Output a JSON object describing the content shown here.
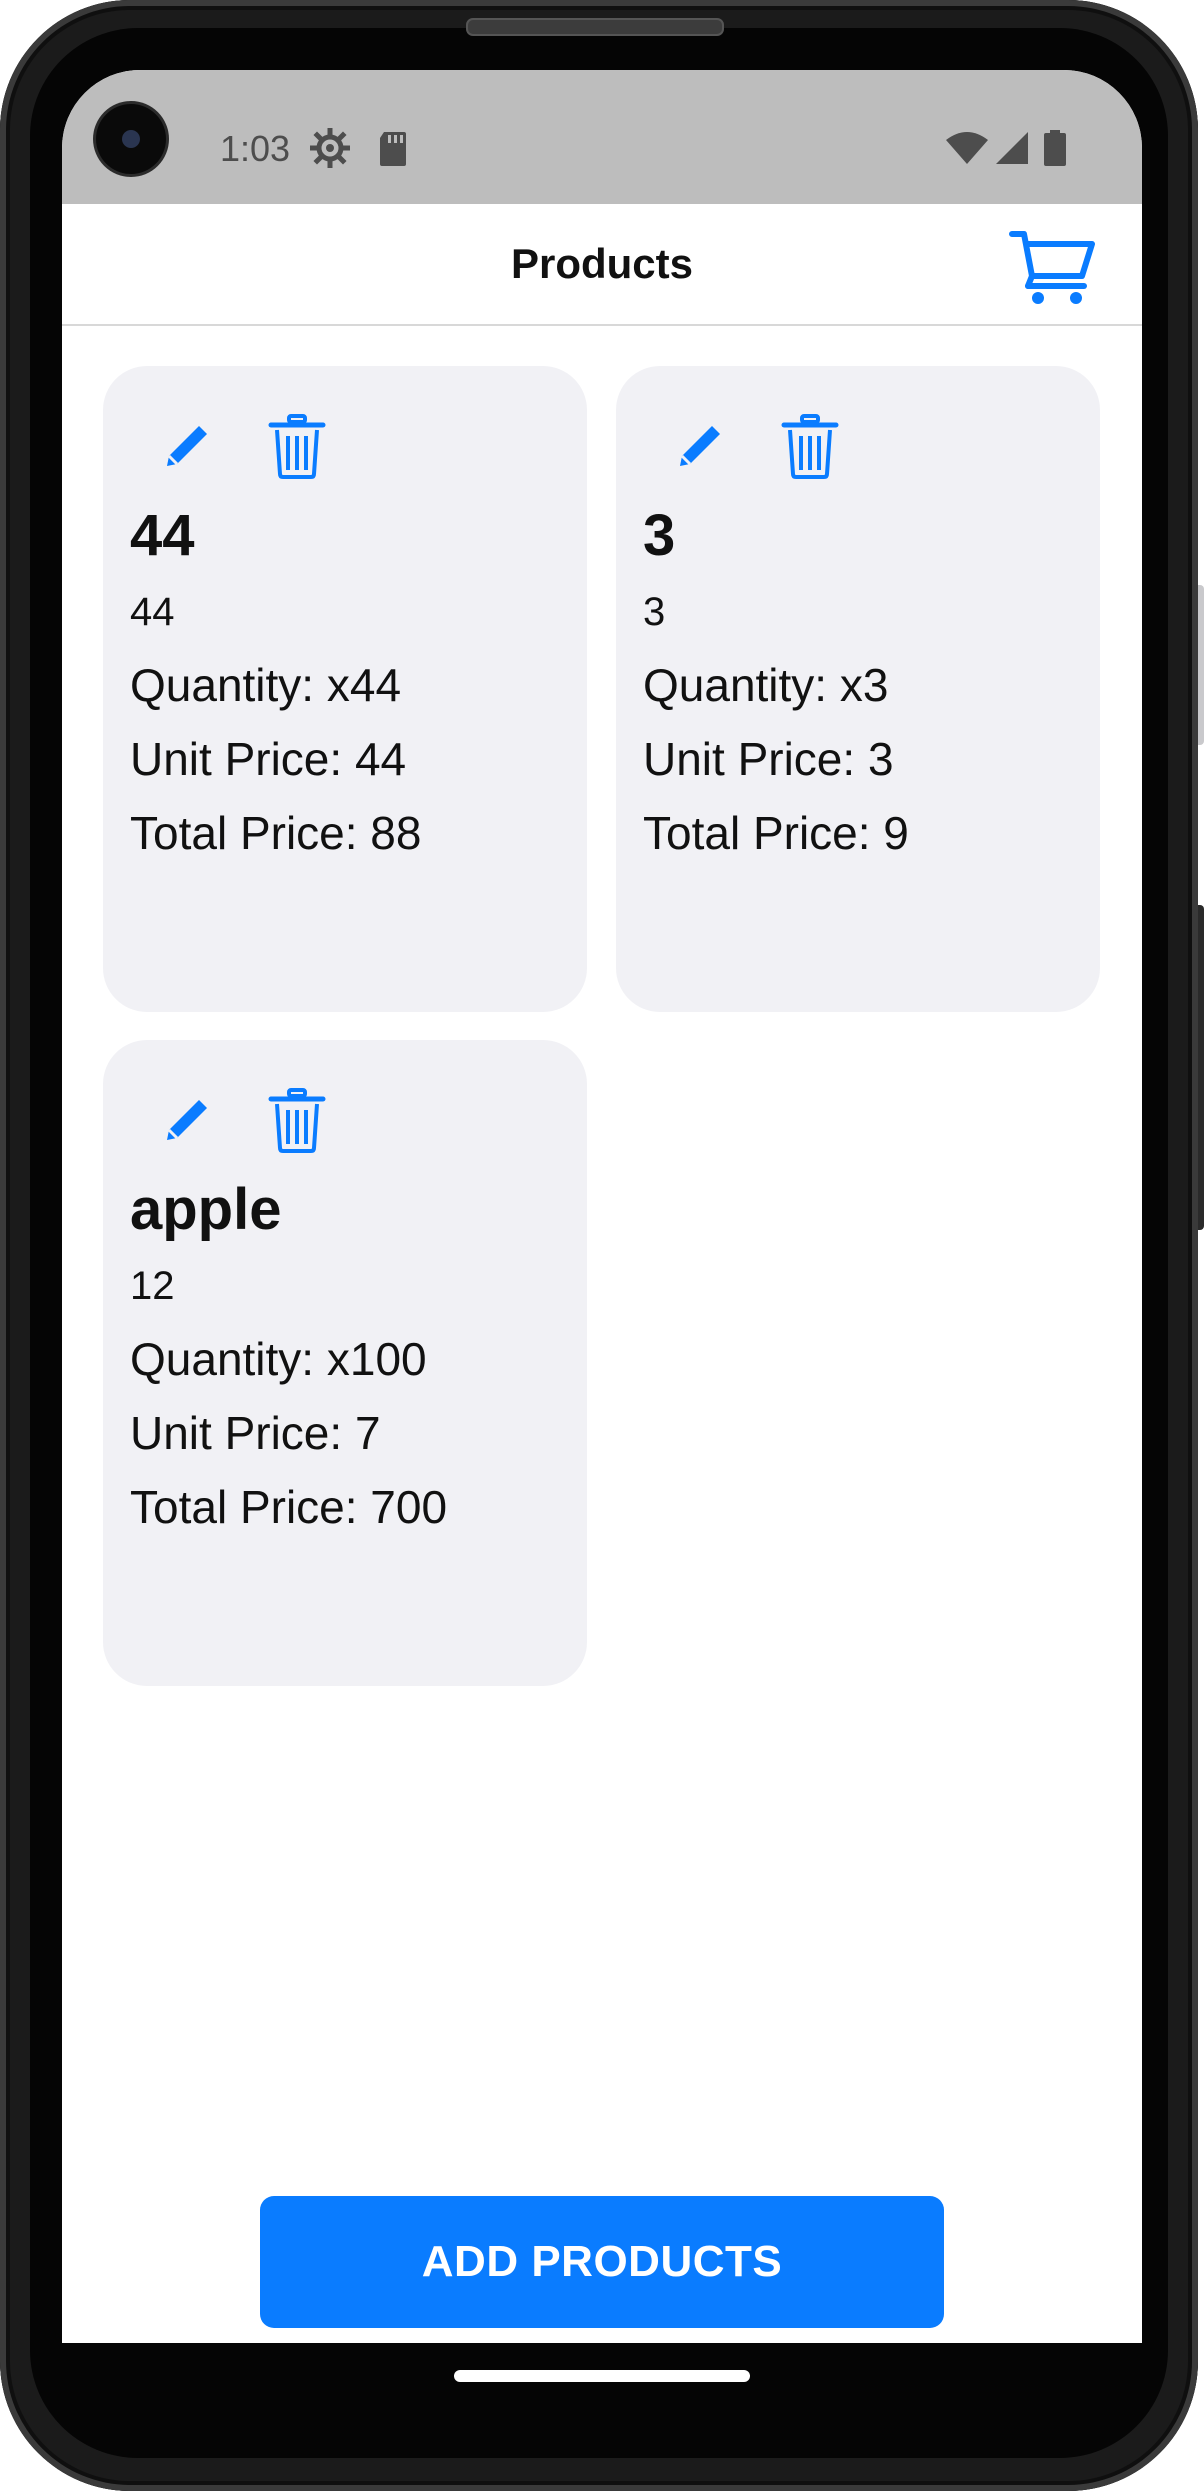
{
  "status_bar": {
    "time": "1:03",
    "icons": [
      "settings-gear-icon",
      "sd-card-icon",
      "wifi-icon",
      "cell-signal-icon",
      "battery-icon"
    ]
  },
  "header": {
    "title": "Products",
    "cart_icon": "shopping-cart-icon"
  },
  "products": [
    {
      "name": "44",
      "description": "44",
      "quantity": "Quantity: x44",
      "unit_price": "Unit Price: 44",
      "total_price": "Total Price: 88",
      "edit_icon": "pencil-icon",
      "delete_icon": "trash-icon"
    },
    {
      "name": "3",
      "description": "3",
      "quantity": "Quantity: x3",
      "unit_price": "Unit Price: 3",
      "total_price": "Total Price: 9",
      "edit_icon": "pencil-icon",
      "delete_icon": "trash-icon"
    },
    {
      "name": "apple",
      "description": "12",
      "quantity": "Quantity: x100",
      "unit_price": "Unit Price: 7",
      "total_price": "Total Price: 700",
      "edit_icon": "pencil-icon",
      "delete_icon": "trash-icon"
    }
  ],
  "footer": {
    "add_button_label": "ADD PRODUCTS"
  },
  "colors": {
    "accent": "#0a7cff",
    "card_background": "#f1f1f5",
    "status_bar": "#bdbdbd"
  }
}
